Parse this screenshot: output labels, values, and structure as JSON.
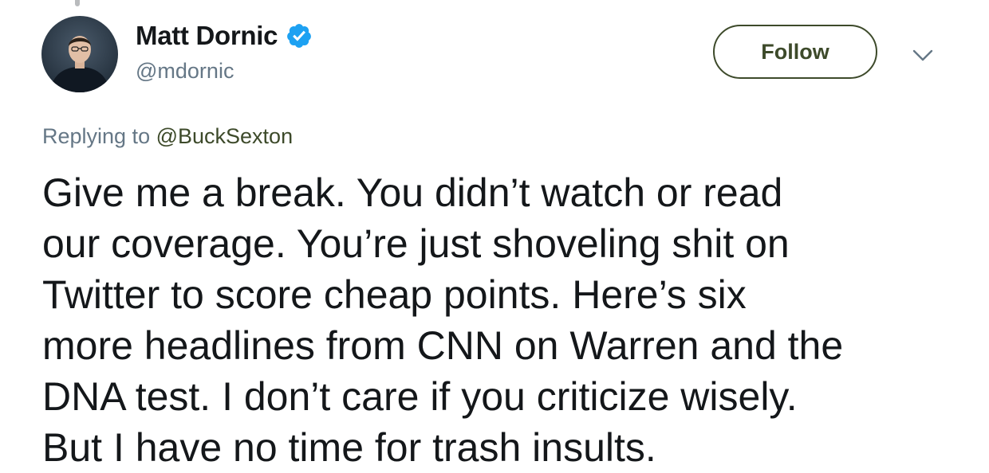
{
  "tweet": {
    "author": {
      "name": "Matt Dornic",
      "handle": "@mdornic",
      "verified": true,
      "avatar_icon": "avatar-photo"
    },
    "follow_label": "Follow",
    "menu_icon": "chevron-down-icon",
    "replying_prefix": "Replying to ",
    "replying_to": "@BuckSexton",
    "text_lines": [
      "Give me a break. You didn’t watch or read",
      "our coverage. You’re just shoveling shit on",
      "Twitter to score cheap points. Here’s six",
      "more headlines from CNN on Warren and the",
      "DNA test. I don’t care if you criticize wisely.",
      "But I have no time for trash insults."
    ]
  },
  "colors": {
    "verified_badge": "#1da1f2",
    "follow_border": "#3d4a2a",
    "secondary_text": "#657786",
    "primary_text": "#14171a"
  }
}
